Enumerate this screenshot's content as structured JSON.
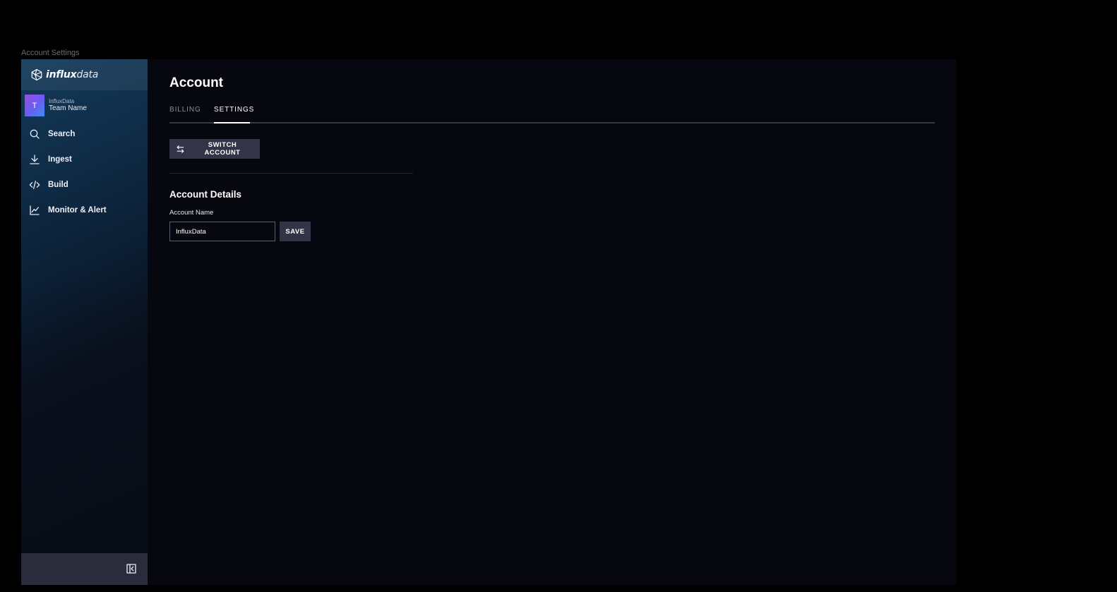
{
  "frame_label": "Account Settings",
  "brand": {
    "logo_bold": "influx",
    "logo_light": "data",
    "logo_icon": "influx-cube-icon"
  },
  "org": {
    "avatar_letter": "T",
    "org_name": "InfluxData",
    "team_name": "Team Name"
  },
  "nav": {
    "items": [
      {
        "label": "Search",
        "icon": "search-icon"
      },
      {
        "label": "Ingest",
        "icon": "download-icon"
      },
      {
        "label": "Build",
        "icon": "code-icon"
      },
      {
        "label": "Monitor & Alert",
        "icon": "line-chart-icon"
      }
    ]
  },
  "footer": {
    "collapse_icon": "collapse-sidebar-icon"
  },
  "page": {
    "title": "Account",
    "tabs": [
      {
        "label": "BILLING",
        "active": false
      },
      {
        "label": "SETTINGS",
        "active": true
      }
    ],
    "switch_account_label": "SWITCH ACCOUNT",
    "section_title": "Account Details",
    "account_name_label": "Account Name",
    "account_name_value": "InfluxData",
    "save_label": "SAVE"
  },
  "colors": {
    "background": "#07080f",
    "button": "#333447",
    "tab_active": "#ffffff",
    "tab_inactive": "#8a8c9e"
  }
}
